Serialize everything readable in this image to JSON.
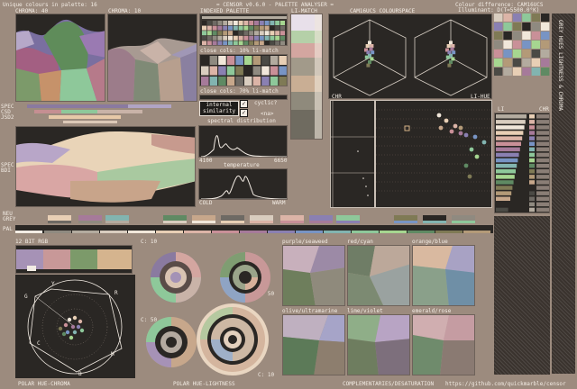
{
  "header": {
    "unique_colours": "Unique colours in palette: 16",
    "title": "= CENSOR v0.6.0 - PALETTE ANALYSER =",
    "colour_difference": "Colour difference: CAM16UCS",
    "illuminant": "Illuminant: D(T=5500.0°K)"
  },
  "labels": {
    "chroma40": "CHROMA: 40",
    "chroma10": "CHROMA: 10",
    "indexed_palette": "INDEXED PALETTE",
    "li_match": "LI-MATCH",
    "cam16": "CAM16UCS COLOURSPACE",
    "close_cols_10": "close cols: 10% li-match",
    "close_cols_70": "close cols: 70% li-match",
    "internal_similarity": "internal similarity",
    "cyclic": "cyclic?",
    "na": "<na>",
    "spectral_distribution": "spectral distribution",
    "spec_min": "4100",
    "spec_max": "6650",
    "temperature": "temperature",
    "cold": "COLD",
    "warm": "WARM",
    "chr": "CHR",
    "li_hue": "LI-HUE",
    "li": "LI",
    "chr2": "CHR",
    "spec_csd2": [
      "SPEC",
      "CSD",
      "JSD2"
    ],
    "spec_bdi": [
      "SPEC",
      "BDI"
    ],
    "neu": "NEU",
    "grey": "GREY",
    "pal": "PAL",
    "bit12": "12 BIT RGB",
    "polar_hue_chroma": "POLAR HUE-CHROMA",
    "polar_hue_lightness": "POLAR HUE-LIGHTNESS",
    "complementaries": "COMPLEMENTARIES/DESATURATION",
    "github": "https://github.com/quickmarble/censor",
    "c10a": "C: 10",
    "c50a": "C: 50",
    "c50b": "C: 50",
    "c10b": "C: 10",
    "purple_seaweed": "purple/seaweed",
    "red_cyan": "red/cyan",
    "orange_blue": "orange/blue",
    "olive_ultramarine": "olive/ultramarine",
    "lime_violet": "lime/violet",
    "emerald_rose": "emerald/rose",
    "side_text": "GREY HUES  LIGHTNESS & CHROMA",
    "wheel_g": "G",
    "wheel_y": "Y",
    "wheel_r": "R",
    "wheel_c": "C",
    "wheel_b": "B",
    "wheel_m": "M"
  },
  "palette": [
    "#2a2724",
    "#4b4a45",
    "#6e6a64",
    "#8f8a80",
    "#b3ab9f",
    "#d9cdbf",
    "#f1e7da",
    "#e8cfb5",
    "#dcb4a7",
    "#c99098",
    "#a67a9a",
    "#8a80b2",
    "#7894c4",
    "#82b4b0",
    "#8ec89a",
    "#a6d690",
    "#5f8a63",
    "#7f7a55",
    "#b39a78",
    "#c7a78b"
  ],
  "colors": {
    "bg": "#9c8b7e",
    "panel": "#2a2724",
    "text": "#f3ece4"
  }
}
